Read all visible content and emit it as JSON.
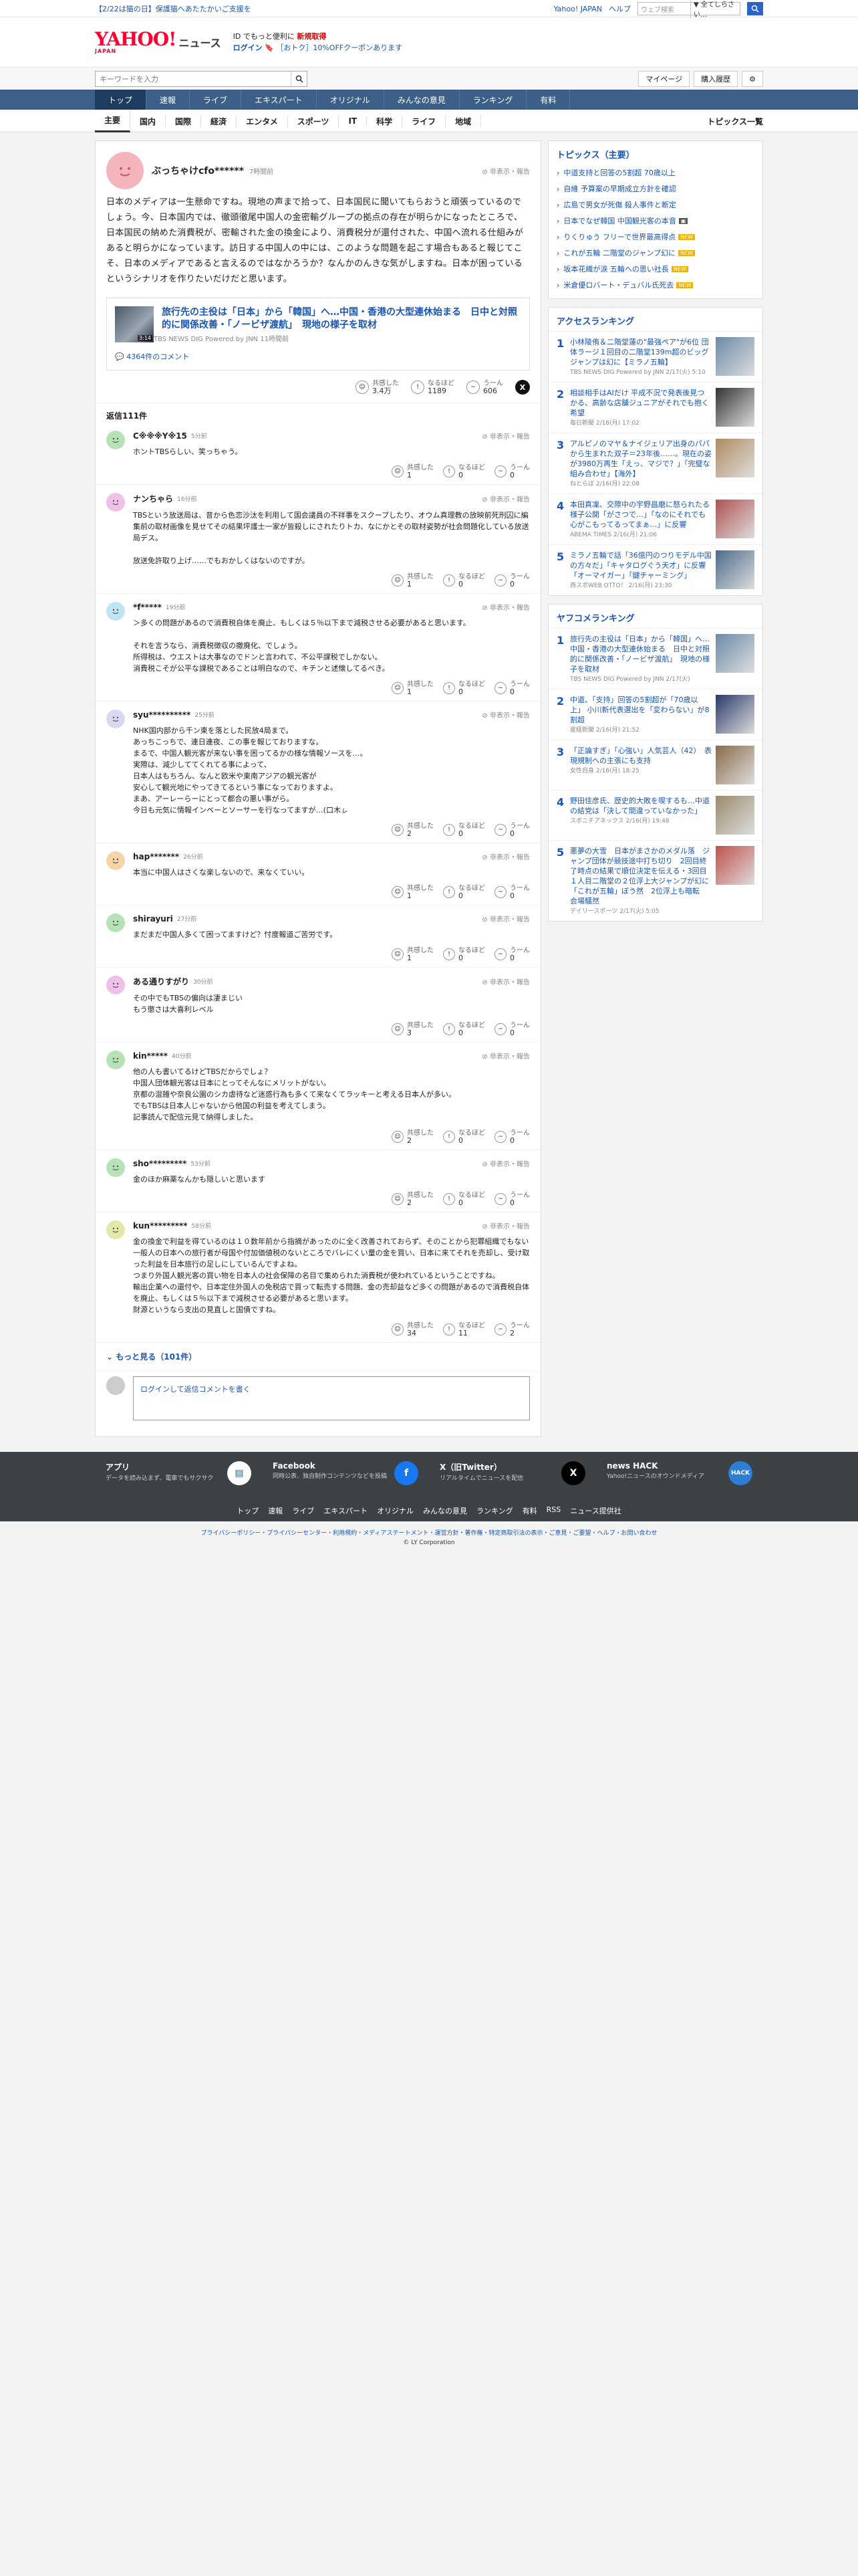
{
  "topbar": {
    "promo": "【2/22は猫の日】保護猫へあたたかいご支援を",
    "yahoo_japan": "Yahoo! JAPAN",
    "help": "ヘルプ",
    "web_search_placeholder": "ウェブ検索",
    "scope": "▼ 全てしらさい…"
  },
  "masthead": {
    "logo": "YAHOO!",
    "logo_sub": "JAPAN",
    "news": "ニュース",
    "promo1": "ID でもっと便利に",
    "promo1_strong": "新規取得",
    "login": "ログイン",
    "coupon": "［おトク］10%OFFクーポンあります"
  },
  "search": {
    "placeholder": "キーワードを入力",
    "mypage": "マイページ",
    "history": "購入履歴"
  },
  "gnav": [
    "トップ",
    "速報",
    "ライブ",
    "エキスパート",
    "オリジナル",
    "みんなの意見",
    "ランキング",
    "有料"
  ],
  "subnav": [
    "主要",
    "国内",
    "国際",
    "経済",
    "エンタメ",
    "スポーツ",
    "IT",
    "科学",
    "ライフ",
    "地域"
  ],
  "subnav_right": "トピックス一覧",
  "parent": {
    "user": "ぶっちゃけcfo******",
    "time": "7時間前",
    "flag": "非表示・報告",
    "text": "日本のメディアは一生懸命ですね。現地の声まで拾って、日本国民に聞いてもらおうと頑張っているのでしょう。今、日本国内では、徹頭徹尾中国人の金密輸グループの拠点の存在が明らかになったところで、日本国民の納めた消費税が、密輸された金の換金により、消費税分が還付された、中国へ流れる仕組みがあると明らかになっています。訪日する中国人の中には、このような問題を起こす場合もあると報じてこそ、日本のメディアであると言えるのではなかろうか？なんかのんきな気がしますね。日本が困っているというシナリオを作りたいだけだと思います。",
    "article_title": "旅行先の主役は「日本」から「韓国」へ…中国・香港の大型連休始まる　日中と対照的に関係改善・「ノービザ渡航」　現地の様子を取材",
    "article_src": "TBS NEWS DIG Powered by JNN 11時間前",
    "article_thumb_time": "3:14",
    "article_comments": "4364件のコメント",
    "reacts": [
      {
        "label": "共感した",
        "count": "3.4万"
      },
      {
        "label": "なるほど",
        "count": "1189"
      },
      {
        "label": "うーん",
        "count": "606"
      }
    ]
  },
  "reply_count": "返信111件",
  "reactions_labels": [
    "共感した",
    "なるほど",
    "うーん"
  ],
  "replies": [
    {
      "user": "C※※※Y※15",
      "time": "5分前",
      "text": "ホントTBSらしい、笑っちゃう。",
      "counts": [
        "1",
        "0",
        "0"
      ],
      "color": "#b6e2b6"
    },
    {
      "user": "ナンちゃら",
      "time": "16分前",
      "text": "TBSという放送局は、昔から色恋沙汰を利用して国会議員の不祥事をスクープしたり、オウム真理教の放映前死刑囚に編集前の取材画像を見せてその結果坪護士一家が皆殺しにされたりトカ、なにかとその取材姿勢が社会問題化している放送局デス。\n\n放送免許取り上げ……でもおかしくはないのですが。",
      "counts": [
        "1",
        "0",
        "0"
      ],
      "color": "#f0c0e8"
    },
    {
      "user": "*f*****",
      "time": "19分前",
      "text": "＞多くの問題があるので消費税自体を廃止、もしくは５％以下まで減税させる必要があると思います。\n\nそれを言うなら、消費税徴収の撤廃化、でしょう。\n所得税は、ウエストは大事なのでドンと言われて、不公平課税でしかない。\n消費税こそが公平な課税であることは明白なので、キチンと述懐してるべき。",
      "counts": [
        "1",
        "0",
        "0"
      ],
      "color": "#bfe4f5"
    },
    {
      "user": "syu**********",
      "time": "25分前",
      "text": "NHK国内部から千ン東を落とした民放4局まで。\nあっちこっちで、連日連夜、この事を報じておりますな。\nまるで、中国人観光客が来ない事を困ってるかの様な情報ソースを…。\n実際は、減少しててくれてる事によって、\n日本人はもちろん、なんと欧米や東南アジアの観光客が\n安心して観光地にやってきてるという事になっておりますよ。\nまあ、アーレーらーにとって都合の悪い事がら。\n今日も元気に情報インベーとソーサーを行なってますが…(口木ㇾ",
      "counts": [
        "2",
        "0",
        "0"
      ],
      "color": "#d8d8f0"
    },
    {
      "user": "hap*******",
      "time": "26分前",
      "text": "本当に中国人はさくな楽しないので、来なくていい。",
      "counts": [
        "1",
        "0",
        "0"
      ],
      "color": "#f5d4a8"
    },
    {
      "user": "shirayuri",
      "time": "27分前",
      "text": "まだまだ中国人多くて困ってますけど？忖度報道ご苦労です。",
      "counts": [
        "1",
        "0",
        "0"
      ],
      "color": "#b6e2b6"
    },
    {
      "user": "ある通りすがり",
      "time": "30分前",
      "text": "その中でもTBSの偏向は凄まじい\nもう懲さは大喜利レベル",
      "counts": [
        "3",
        "0",
        "0"
      ],
      "color": "#f0c0e8"
    },
    {
      "user": "kin*****",
      "time": "40分前",
      "text": "他の人も書いてるけどTBSだからでしょ？\n中国人団体観光客は日本にとってそんなにメリットがない。\n京都の混雑や奈良公園のシカ虐待など迷惑行為も多くて来なくてラッキーと考える日本人が多い。\nでもTBSは日本人じゃないから他国の利益を考えてしまう。\n記事読んで配信元見て納得しました。",
      "counts": [
        "2",
        "0",
        "0"
      ],
      "color": "#b6e2b6"
    },
    {
      "user": "sho*********",
      "time": "53分前",
      "text": "金のほか麻薬なんかも隠しいと思います",
      "counts": [
        "2",
        "0",
        "0"
      ],
      "color": "#b6e2b6"
    },
    {
      "user": "kun*********",
      "time": "58分前",
      "text": "金の換金で利益を得ているのは１０数年前から指摘があったのに全く改善されておらず、そのことから犯罪組織でもない一般人の日本への旅行者が母国や付加価値税のないところでバレにくい量の金を買い、日本に来てそれを売却し、受け取った利益を日本旅行の足しにしているんですよね。\nつまり外国人観光客の買い物を日本人の社会保障の名目で集められた消費税が使われているということですね。\n輸出企業への還付や、日本定住外国人の免税店で買って転売する問題、金の売却益など多くの問題があるので消費税自体を廃止、もしくは５％以下まで減税させる必要があると思います。\n財源というなら支出の見直しと国債ですね。",
      "counts": [
        "34",
        "11",
        "2"
      ],
      "color": "#e3e8a8"
    }
  ],
  "more": "もっと見る（101件）",
  "reply_box": {
    "login": "ログイン",
    "rest": "して返信コメントを書く"
  },
  "side": {
    "topics_title": "トピックス（主要）",
    "topics": [
      {
        "t": "中道支持と回答の5割超 70歳以上",
        "b": ""
      },
      {
        "t": "自維 予算案の早期成立方針を確認",
        "b": ""
      },
      {
        "t": "広島で男女が死傷 殺人事件と断定",
        "b": ""
      },
      {
        "t": "日本でなぜ韓国 中国観光客の本音",
        "b": "ph"
      },
      {
        "t": "りくりゅう フリーで世界最高得点",
        "b": "new"
      },
      {
        "t": "これが五輪 二階堂のジャンプ幻に",
        "b": "new"
      },
      {
        "t": "坂本花織が涙 五輪への思い社長",
        "b": "new"
      },
      {
        "t": "米倉優ロバート・デュバル氏死去",
        "b": "new"
      }
    ],
    "access_title": "アクセスランキング",
    "access": [
      {
        "n": "1",
        "t": "小林陵侑＆二階堂蓮の\"最強ペア\"が6位 団体ラージ１回目の二階堂139m超のビッグジャンプは幻に【ミラノ五輪】",
        "s": "TBS NEWS DIG Powered by JNN 2/17(火) 5:10",
        "c": "#6b8aa8"
      },
      {
        "n": "2",
        "t": "相談相手はAIだけ 平成不況で発表後見つかる、高齢な店舗ジュニアがそれでも抱く希望",
        "s": "毎日新聞 2/16(月) 17:02",
        "c": "#333"
      },
      {
        "n": "3",
        "t": "アルピノのマヤ＆ナイジェリア出身のパパから生まれた双子＝23年後……。現在の姿が3980万再生「えっ、マジで？」「完璧な組み合わせ」【海外】",
        "s": "ねとらぼ 2/16(月) 22:08",
        "c": "#b08a60"
      },
      {
        "n": "4",
        "t": "本田真凜、交際中の宇野昌磨に怒られたる様子公開「がさつで…」「なのにそれでも心がこもってるってまぁ…」に反響",
        "s": "ABEMA TIMES 2/16(月) 21:06",
        "c": "#b05050"
      },
      {
        "n": "5",
        "t": "ミラノ五輪で話「36億円のつりモデル中国の方々だ」「キャタログぐう天才」に反響「オーマイガー」「鍵チャーミング」",
        "s": "西スポWEB OTTO！ 2/16(月) 23:30",
        "c": "#4a6a8a"
      }
    ],
    "yahoo_title": "ヤフコメランキング",
    "yahoo": [
      {
        "n": "1",
        "t": "旅行先の主役は「日本」から「韓国」へ…中国・香港の大型連休始まる　日中と対照的に関係改善・「ノービザ渡航」　現地の様子を取材",
        "s": "TBS NEWS DIG Powered by JNN 2/17(火)",
        "c": "#6b8aa8"
      },
      {
        "n": "2",
        "t": "中道、「支持」回答の5割超が「70歳以上」 小川新代表選出を「変わらない」が8割超",
        "s": "産経新聞 2/16(月) 21:52",
        "c": "#2a3a6a"
      },
      {
        "n": "3",
        "t": "「正論すぎ」「心強い」人気芸人（42）　表現規制への主張にも支持",
        "s": "女性自身 2/16(月) 18:25",
        "c": "#8a6a4a"
      },
      {
        "n": "4",
        "t": "野田佳彦氏、歴史的大敗を喫するも…中道の結党は「決して間違っていなかった」",
        "s": "スポニチアネックス 2/16(月) 19:48",
        "c": "#9a8a6a"
      },
      {
        "n": "5",
        "t": "悪夢の大雪　日本がまさかのメダル落　ジャンプ団体が競技途中打ち切り　2回目終了時点の結果で順位決定を伝える・3回目１人目二階堂の２位浮上大ジャンプが幻に「これが五輪」ぼう然　2位浮上も暗転　会場騒然",
        "s": "デイリースポーツ 2/17(火) 5:05",
        "c": "#c0504a"
      }
    ]
  },
  "footer": {
    "apps": [
      {
        "t": "アプリ",
        "d": "データを読み込まず、電車でもサクサク"
      },
      {
        "t": "Facebook",
        "d": "同時公表、独自制作コンテンツなどを投稿"
      },
      {
        "t": "X（旧Twitter）",
        "d": "リアルタイムでニュースを配信"
      },
      {
        "t": "news HACK",
        "d": "Yahoo!ニュースのオウンドメディア"
      }
    ],
    "links": [
      "トップ",
      "速報",
      "ライブ",
      "エキスパート",
      "オリジナル",
      "みんなの意見",
      "ランキング",
      "有料",
      "RSS",
      "ニュース提供社"
    ],
    "legal": "プライバシーポリシー・プライバシーセンター・利用規約・メディアステートメント・運営方針・著作権・特定商取引法の表示・ご意見・ご要望・ヘルプ・お問い合わせ",
    "copyright": "© LY Corporation"
  }
}
